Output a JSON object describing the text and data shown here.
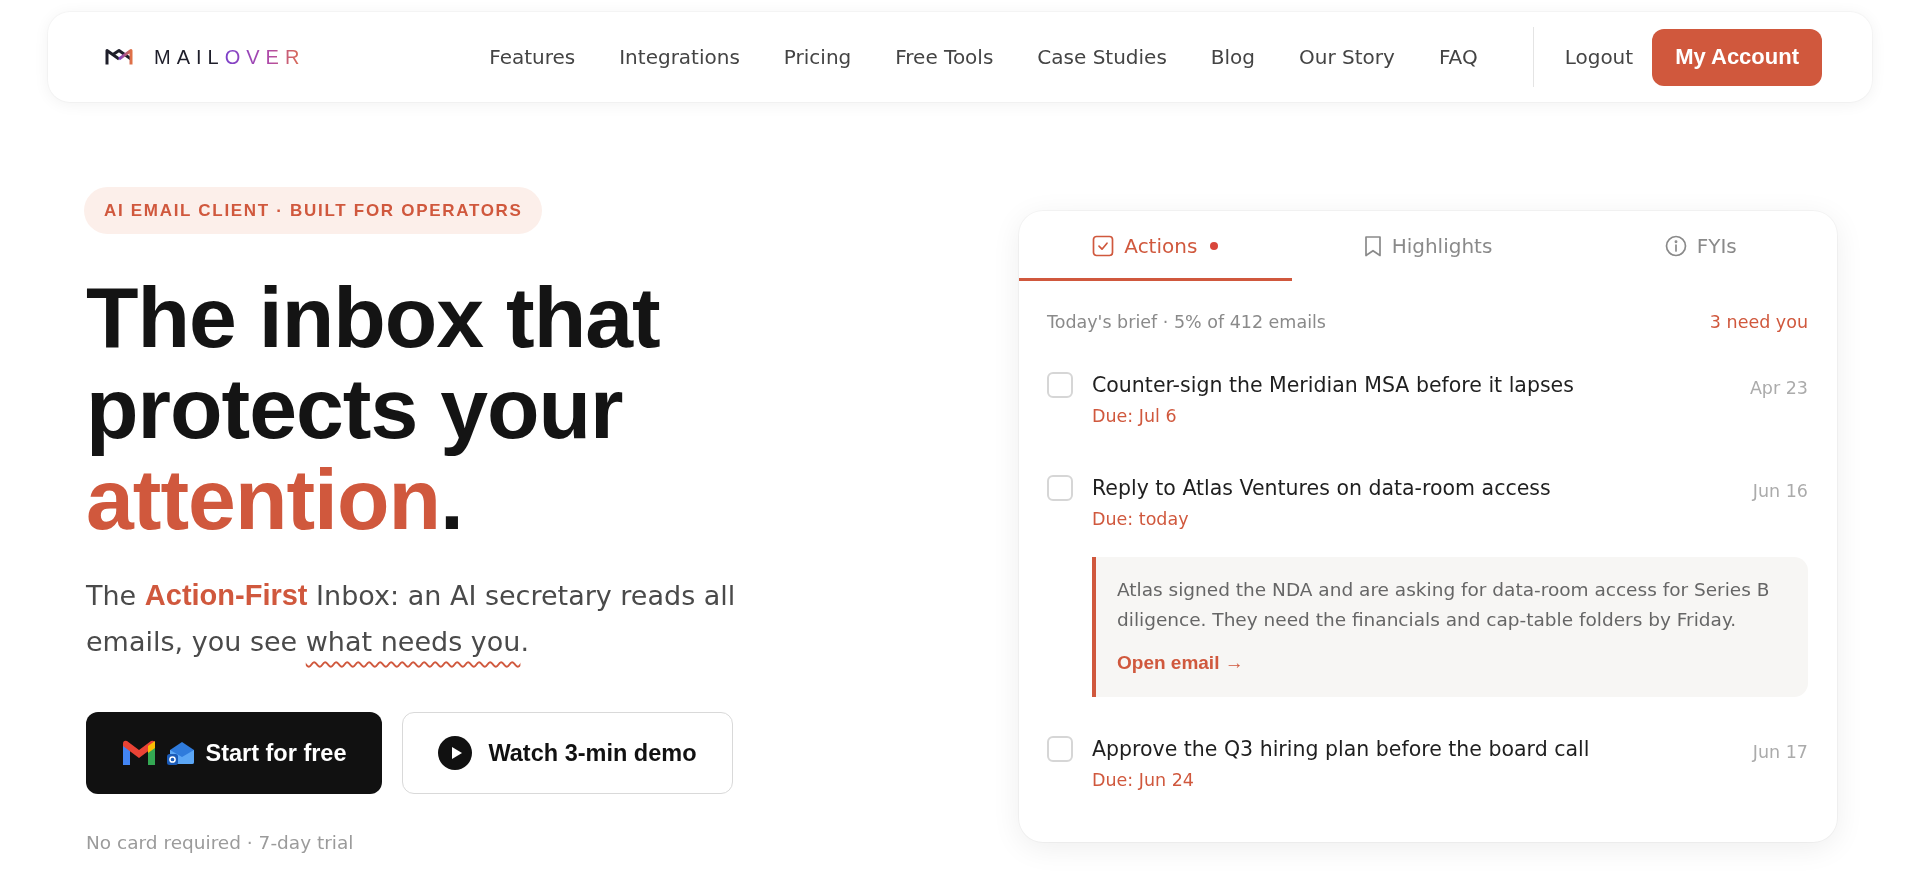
{
  "nav": {
    "logo": [
      {
        "kind": "plain",
        "text": "MAIL"
      },
      {
        "kind": "gradient",
        "text": "OVER"
      }
    ],
    "links": [
      "Features",
      "Integrations",
      "Pricing",
      "Free Tools",
      "Case Studies",
      "Blog",
      "Our Story",
      "FAQ"
    ],
    "logout": "Logout",
    "account_button": "My Account"
  },
  "hero": {
    "badge": "AI EMAIL CLIENT · BUILT FOR OPERATORS",
    "headline": [
      {
        "kind": "plain",
        "text": "The inbox that protects your "
      },
      {
        "kind": "accent",
        "text": "attention"
      },
      {
        "kind": "plain",
        "text": "."
      }
    ],
    "lead": [
      {
        "kind": "plain",
        "text": "The "
      },
      {
        "kind": "accent",
        "text": "Action-First"
      },
      {
        "kind": "plain",
        "text": " Inbox: an AI secretary reads all emails, you see "
      },
      {
        "kind": "wavy",
        "text": "what needs you"
      },
      {
        "kind": "plain",
        "text": "."
      }
    ],
    "buttons": [
      {
        "kind": "primary",
        "label": "Start for free"
      },
      {
        "kind": "secondary",
        "label": "Watch 3-min demo"
      }
    ],
    "footnote": "No card required · 7-day trial"
  },
  "brief": {
    "tabs": [
      {
        "label": "Actions",
        "selected": true,
        "alert": true
      },
      {
        "label": "Highlights",
        "selected": false,
        "alert": false
      },
      {
        "label": "FYIs",
        "selected": false,
        "alert": false
      }
    ],
    "summary": "Today's brief · 5% of 412 emails",
    "count": "3 need you",
    "items": [
      {
        "title": "Counter-sign the Meridian MSA before it lapses",
        "due": "Due: Jul 6",
        "date": "Apr 23",
        "checked": false
      },
      {
        "title": "Reply to Atlas Ventures on data-room access",
        "due": "Due: today",
        "date": "Jun 16",
        "checked": false,
        "detail": {
          "summary": "Atlas signed the NDA and are asking for data-room access for Series B diligence. They need the financials and cap-table folders by Friday.",
          "link": "Open email →"
        }
      },
      {
        "title": "Approve the Q3 hiring plan before the board call",
        "due": "Due: Jun 24",
        "date": "Jun 17",
        "checked": false
      }
    ]
  }
}
